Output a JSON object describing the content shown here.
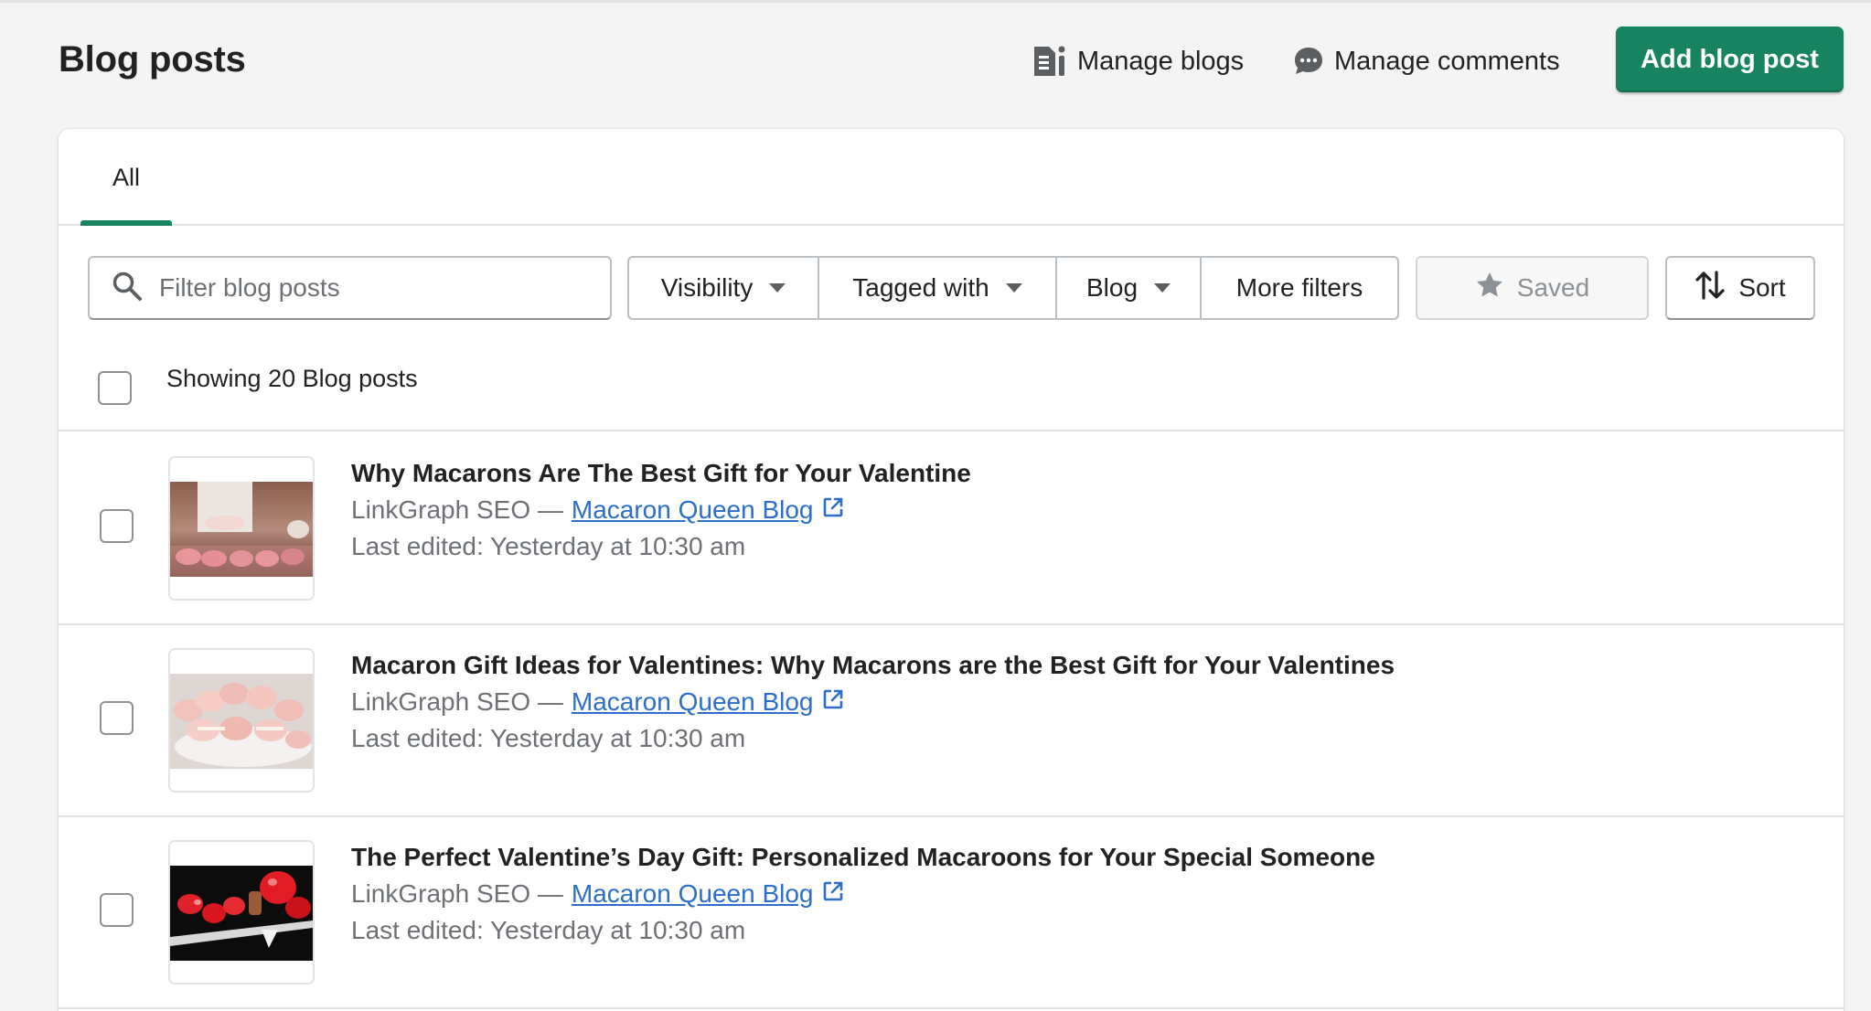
{
  "header": {
    "title": "Blog posts",
    "manage_blogs_label": "Manage blogs",
    "manage_comments_label": "Manage comments",
    "add_button_label": "Add blog post"
  },
  "tabs": [
    {
      "label": "All",
      "active": true
    }
  ],
  "filters": {
    "search_placeholder": "Filter blog posts",
    "visibility_label": "Visibility",
    "tagged_label": "Tagged with",
    "blog_label": "Blog",
    "more_filters_label": "More filters",
    "saved_label": "Saved",
    "sort_label": "Sort"
  },
  "list": {
    "showing_text": "Showing 20 Blog posts",
    "posts": [
      {
        "title": "Why Macarons Are The Best Gift for Your Valentine",
        "author": "LinkGraph SEO —",
        "blog": "Macaron Queen Blog",
        "edited": "Last edited: Yesterday at 10:30 am"
      },
      {
        "title": "Macaron Gift Ideas for Valentines: Why Macarons are the Best Gift for Your Valentines",
        "author": "LinkGraph SEO —",
        "blog": "Macaron Queen Blog",
        "edited": "Last edited: Yesterday at 10:30 am"
      },
      {
        "title": "The Perfect Valentine’s Day Gift: Personalized Macaroons for Your Special Someone",
        "author": "LinkGraph SEO —",
        "blog": "Macaron Queen Blog",
        "edited": "Last edited: Yesterday at 10:30 am"
      }
    ]
  },
  "colors": {
    "primary_green": "#188360",
    "link_blue": "#2c6ecb",
    "subdued_text": "#6d7175"
  },
  "icons": [
    "blog-icon",
    "comments-icon",
    "search-icon",
    "caret-down-icon",
    "star-icon",
    "sort-arrows-icon",
    "external-link-icon"
  ]
}
